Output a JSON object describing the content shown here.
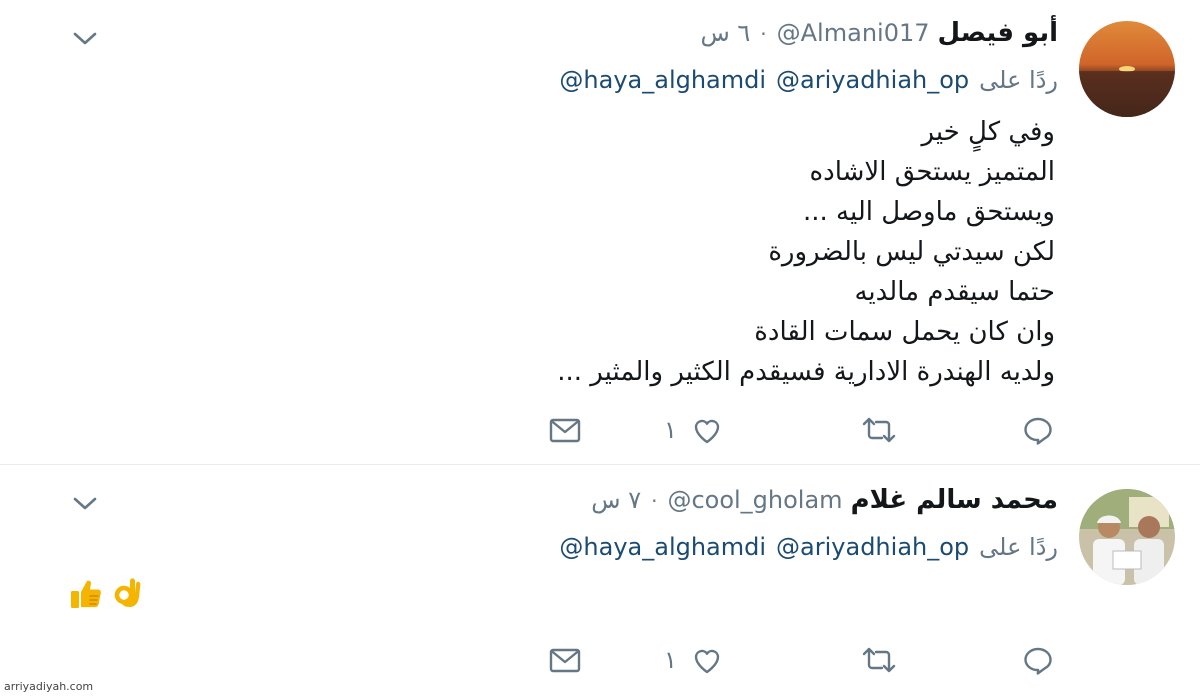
{
  "watermark": "arriyadiyah.com",
  "tweets": [
    {
      "author_name": "أبو فيصل",
      "handle": "@Almani017",
      "separator": "·",
      "time": "٦ س",
      "reply_prefix": "ردًا على",
      "mentions": [
        "@ariyadhiah_op",
        "@haya_alghamdi"
      ],
      "lines": [
        "وفي كلٍ خير",
        "المتميز يستحق الاشاده",
        "ويستحق ماوصل اليه ...",
        "لكن سيدتي ليس بالضرورة",
        "حتما سيقدم مالديه",
        "وان كان يحمل سمات القادة",
        "ولديه الهندرة الادارية فسيقدم الكثير والمثير ..."
      ],
      "like_count": "١",
      "avatar_icon": "sunset-avatar"
    },
    {
      "author_name": "محمد سالم غلام",
      "handle": "@cool_gholam",
      "separator": "·",
      "time": "٧ س",
      "reply_prefix": "ردًا على",
      "mentions": [
        "@ariyadhiah_op",
        "@haya_alghamdi"
      ],
      "emojis": [
        "👍",
        "👌"
      ],
      "like_count": "١",
      "avatar_icon": "two-men-photo-avatar"
    }
  ],
  "colors": {
    "text": "#14171a",
    "secondary": "#657786",
    "mention": "#1b4b72",
    "icon": "#657786",
    "separator": "#e6ecf0"
  }
}
